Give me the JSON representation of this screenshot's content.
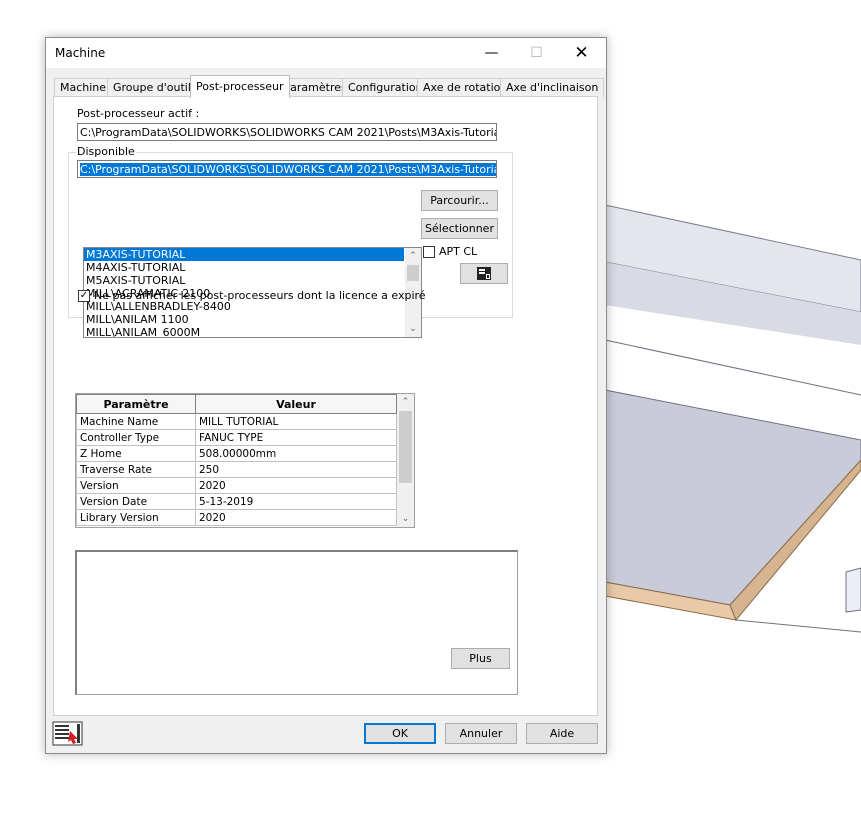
{
  "window": {
    "title": "Machine",
    "minimize": "—",
    "maximize": "☐",
    "close": "✕"
  },
  "tabs": [
    {
      "label": "Machine"
    },
    {
      "label": "Groupe d'outils"
    },
    {
      "label": "Post-processeur"
    },
    {
      "label": "Paramètres"
    },
    {
      "label": "Configuration"
    },
    {
      "label": "Axe de rotation"
    },
    {
      "label": "Axe d'inclinaison"
    }
  ],
  "active_tab": "Post-processeur",
  "post": {
    "active_label": "Post-processeur actif :",
    "active_value": "C:\\ProgramData\\SOLIDWORKS\\SOLIDWORKS CAM 2021\\Posts\\M3Axis-Tutorial.CTL",
    "available_label": "Disponible",
    "available_value": "C:\\ProgramData\\SOLIDWORKS\\SOLIDWORKS CAM 2021\\Posts\\M3Axis-Tutorial.CTL",
    "list": [
      "M3AXIS-TUTORIAL",
      "M4AXIS-TUTORIAL",
      "M5AXIS-TUTORIAL",
      "MILL\\ACRAMATIC-2100",
      "MILL\\ALLENBRADLEY-8400",
      "MILL\\ANILAM 1100",
      "MILL\\ANILAM_6000M"
    ],
    "selected_index": 0,
    "browse_button": "Parcourir...",
    "select_button": "Sélectionner",
    "apt_cl_label": "APT CL",
    "apt_cl_checked": false,
    "hide_expired_label": "Ne pas afficher les post-processeurs dont la licence a expiré",
    "hide_expired_checked": true
  },
  "param_table": {
    "headers": [
      "Paramètre",
      "Valeur"
    ],
    "rows": [
      [
        "Machine Name",
        "MILL TUTORIAL"
      ],
      [
        "Controller Type",
        "FANUC TYPE"
      ],
      [
        "Z Home",
        "508.00000mm"
      ],
      [
        "Traverse Rate",
        "250"
      ],
      [
        "Version",
        "2020"
      ],
      [
        "Version Date",
        "5-13-2019"
      ],
      [
        "Library Version",
        "2020"
      ]
    ]
  },
  "more_button": "Plus",
  "footer": {
    "ok": "OK",
    "cancel": "Annuler",
    "help": "Aide"
  },
  "colors": {
    "selection": "#0078d7",
    "dialog_bg": "#f0f0f0",
    "viewport_plate": "#c9cbd9"
  }
}
